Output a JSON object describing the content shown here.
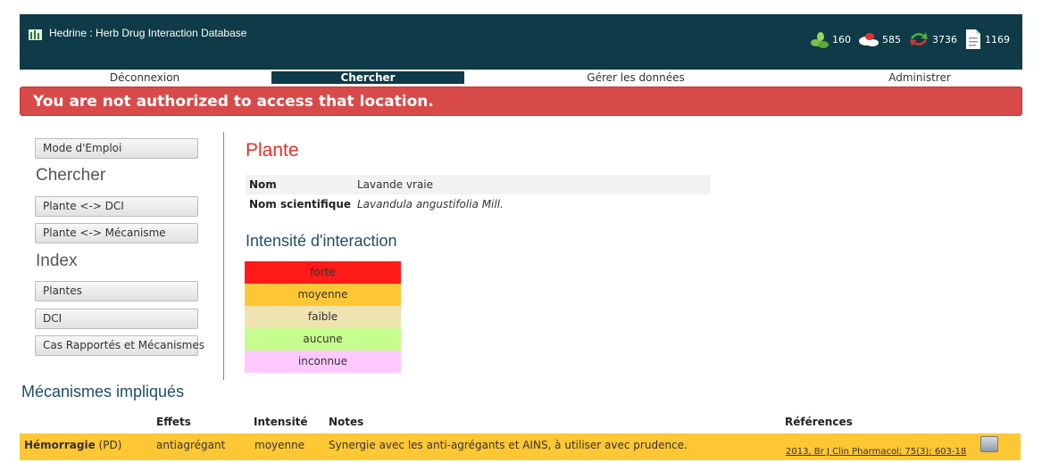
{
  "header": {
    "title": "Hedrine : Herb Drug Interaction Database",
    "stats": [
      {
        "icon": "leaves-icon",
        "value": "160"
      },
      {
        "icon": "pills-icon",
        "value": "585"
      },
      {
        "icon": "interaction-arrows-icon",
        "value": "3736"
      },
      {
        "icon": "document-icon",
        "value": "1169"
      }
    ]
  },
  "nav": {
    "items": [
      {
        "label": "Déconnexion"
      },
      {
        "label": "Chercher",
        "active": true
      },
      {
        "label": "Gérer les données"
      },
      {
        "label": "Administrer"
      }
    ]
  },
  "alert": {
    "message": "You are not authorized to access that location."
  },
  "sidebar": {
    "mode_emploi": "Mode d'Emploi",
    "chercher_heading": "Chercher",
    "chercher_items": [
      "Plante <-> DCI",
      "Plante <-> Mécanisme"
    ],
    "index_heading": "Index",
    "index_items": [
      "Plantes",
      "DCI",
      "Cas Rapportés et Mécanismes"
    ]
  },
  "plant": {
    "heading": "Plante",
    "nom_label": "Nom",
    "nom_value": "Lavande vraie",
    "sci_label": "Nom scientifique",
    "sci_value": "Lavandula angustifolia Mill."
  },
  "intensity": {
    "heading": "Intensité d'interaction",
    "levels": [
      {
        "label": "forte",
        "color": "#ff1a1a"
      },
      {
        "label": "moyenne",
        "color": "#ffc733"
      },
      {
        "label": "faible",
        "color": "#efe3b0"
      },
      {
        "label": "aucune",
        "color": "#c6fd8e"
      },
      {
        "label": "inconnue",
        "color": "#ffc8ff"
      }
    ]
  },
  "mechanisms": {
    "heading": "Mécanismes impliqués",
    "columns": {
      "effets": "Effets",
      "intensite": "Intensité",
      "notes": "Notes",
      "references": "Références"
    },
    "rows": [
      {
        "name": "Hémorragie",
        "type": "(PD)",
        "effet": "antiagrégant",
        "intensite": "moyenne",
        "notes": "Synergie avec les anti-agrégants et AINS, à utiliser avec prudence.",
        "reference": "2013, Br J Clin Pharmacol; 75(3): 603-18"
      }
    ]
  }
}
